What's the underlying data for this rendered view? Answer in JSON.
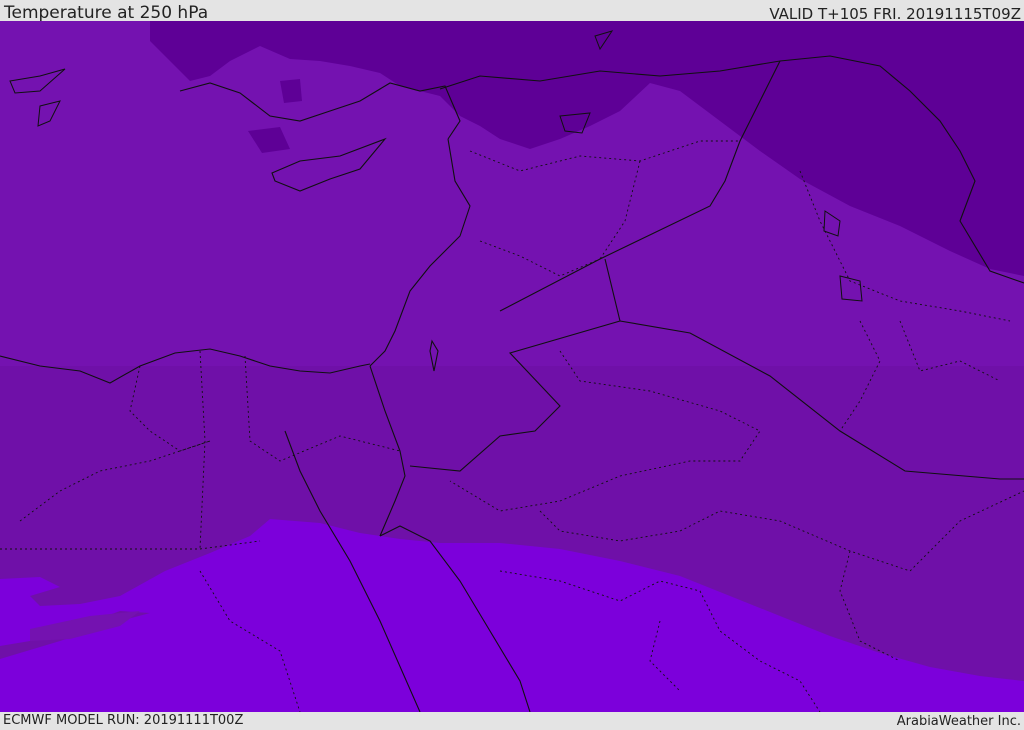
{
  "header": {
    "title": "Temperature at 250 hPa",
    "valid": "VALID T+105 FRI. 20191115T09Z"
  },
  "footer": {
    "model_run": "ECMWF MODEL RUN: 20191111T00Z",
    "credit": "ArabiaWeather Inc."
  },
  "map": {
    "colors": {
      "cold_band": "#5e0096",
      "mid_band": "#7412b0",
      "mid_band_south": "#6f10a8",
      "warm_band": "#7c00db",
      "border": "#101010"
    }
  }
}
